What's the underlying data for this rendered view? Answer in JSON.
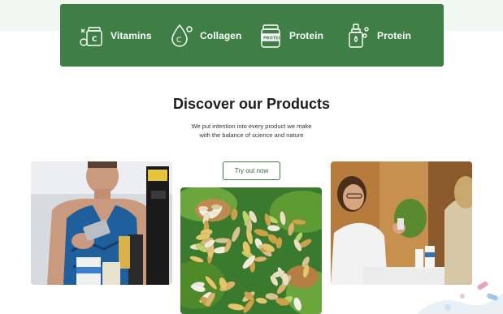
{
  "categories": [
    {
      "label": "Vitamins",
      "icon": "vitamin-bottle-icon"
    },
    {
      "label": "Collagen",
      "icon": "collagen-drop-icon"
    },
    {
      "label": "Protein",
      "icon": "protein-jar-icon"
    },
    {
      "label": "Protein",
      "icon": "dropper-bottle-icon"
    }
  ],
  "section": {
    "title": "Discover our Products",
    "subtitle_line1": "We put intention into every product we make",
    "subtitle_line2": "with the balance of science and nature",
    "cta": "Try out now"
  },
  "images": [
    {
      "name": "man-holding-supplements-photo"
    },
    {
      "name": "capsules-on-leaves-photo"
    },
    {
      "name": "pharmacist-with-customer-photo"
    }
  ],
  "colors": {
    "brand_green": "#3f7f45",
    "top_tint": "#f1f8f1"
  }
}
